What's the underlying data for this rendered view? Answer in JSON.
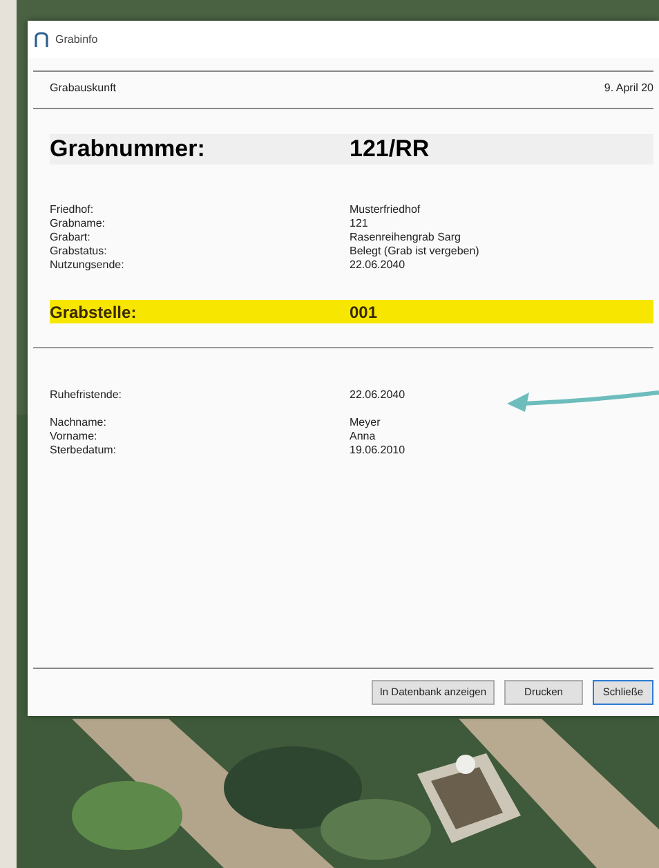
{
  "window": {
    "title": "Grabinfo"
  },
  "report": {
    "heading": "Grabauskunft",
    "date": "9. April 20",
    "grave_number": {
      "label": "Grabnummer:",
      "value": "121/RR"
    },
    "details": [
      {
        "label": "Friedhof:",
        "value": "Musterfriedhof"
      },
      {
        "label": "Grabname:",
        "value": "121"
      },
      {
        "label": "Grabart:",
        "value": "Rasenreihengrab Sarg"
      },
      {
        "label": "Grabstatus:",
        "value": "Belegt (Grab ist vergeben)"
      },
      {
        "label": "Nutzungsende:",
        "value": "22.06.2040"
      }
    ],
    "grave_site": {
      "label": "Grabstelle:",
      "value": "001"
    },
    "rest_period": {
      "label": "Ruhefristende:",
      "value": "22.06.2040"
    },
    "person": [
      {
        "label": "Nachname:",
        "value": "Meyer"
      },
      {
        "label": "Vorname:",
        "value": "Anna"
      },
      {
        "label": "Sterbedatum:",
        "value": "19.06.2010"
      }
    ]
  },
  "buttons": [
    {
      "label": "In Datenbank anzeigen",
      "default": false
    },
    {
      "label": "Drucken",
      "default": false
    },
    {
      "label": "Schließe",
      "default": true
    }
  ]
}
